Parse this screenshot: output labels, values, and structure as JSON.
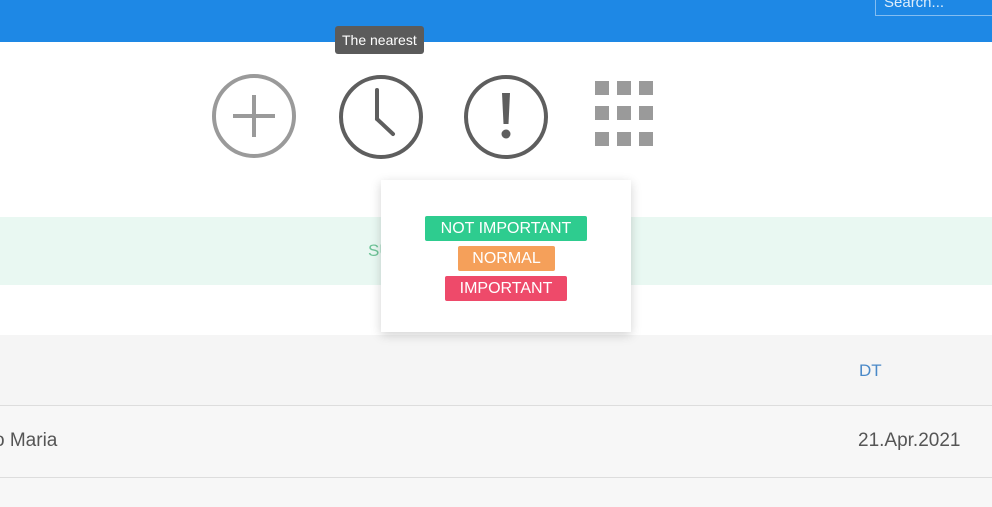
{
  "header": {
    "search_placeholder": "Search..."
  },
  "tooltip": {
    "text": "The nearest"
  },
  "toolbar": {
    "icons": [
      "plus-circle-icon",
      "clock-icon",
      "exclamation-icon",
      "grid-icon"
    ]
  },
  "notice": {
    "text": "SU"
  },
  "priority_menu": {
    "items": [
      {
        "label": "NOT IMPORTANT",
        "color": "#2ecc8f"
      },
      {
        "label": "NORMAL",
        "color": "#f5a05a"
      },
      {
        "label": "IMPORTANT",
        "color": "#ee4a6a"
      }
    ]
  },
  "table": {
    "columns": {
      "dt": "DT"
    },
    "rows": [
      {
        "name": "o Maria",
        "date": "21.Apr.2021"
      }
    ]
  },
  "colors": {
    "header": "#1e88e5",
    "success_band": "#e9f8f2",
    "accent_link": "#4a89c8"
  }
}
